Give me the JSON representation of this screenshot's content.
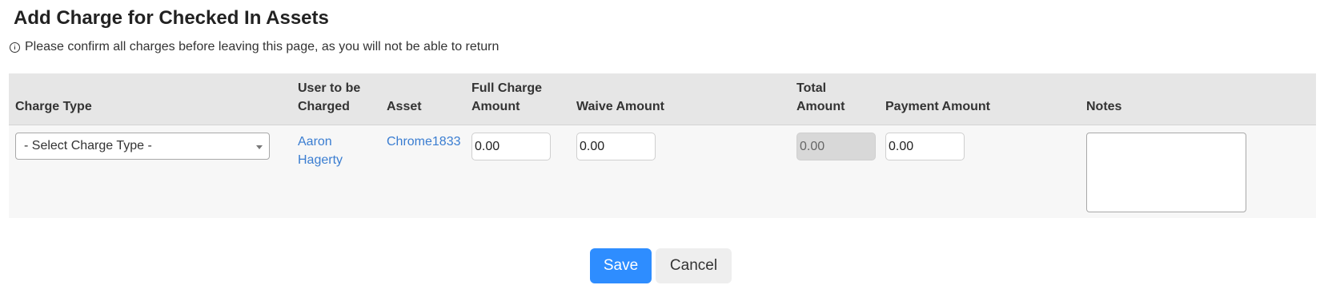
{
  "page": {
    "title": "Add Charge for Checked In Assets",
    "notice": "Please confirm all charges before leaving this page, as you will not be able to return"
  },
  "table": {
    "headers": {
      "charge_type": "Charge Type",
      "user": "User to be Charged",
      "asset": "Asset",
      "full_charge": "Full Charge Amount",
      "waive": "Waive Amount",
      "total": "Total Amount",
      "payment": "Payment Amount",
      "notes": "Notes"
    },
    "row": {
      "charge_type_selected": "- Select Charge Type -",
      "user": "Aaron Hagerty",
      "asset": "Chrome1833",
      "full_charge": "0.00",
      "waive": "0.00",
      "total": "0.00",
      "payment": "0.00",
      "notes": ""
    }
  },
  "actions": {
    "save_label": "Save",
    "cancel_label": "Cancel"
  },
  "colors": {
    "link": "#3a7dd1",
    "primary": "#2e8dff",
    "header_bg": "#e6e6e6"
  }
}
